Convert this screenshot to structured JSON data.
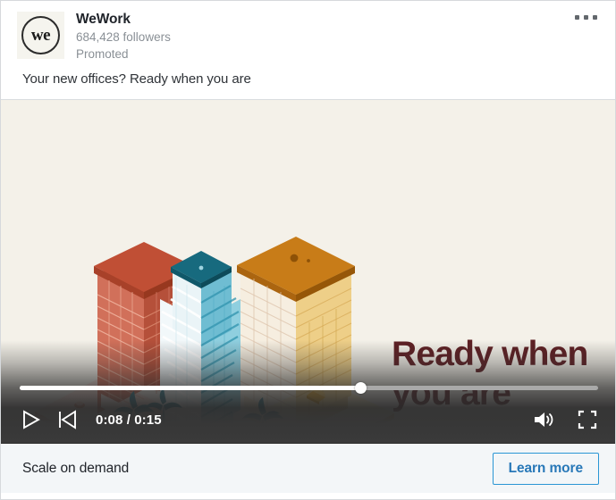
{
  "post": {
    "brand_name": "WeWork",
    "followers": "684,428 followers",
    "promoted_label": "Promoted",
    "avatar_text": "we",
    "commentary": "Your new offices? Ready when you are",
    "more_menu_label": "More options"
  },
  "video": {
    "headline": "Ready when\nyou are",
    "background_color": "#f4f1e9",
    "headline_color": "#5e1f23",
    "buildings": [
      {
        "name": "red-tower",
        "body_color": "#c4593f",
        "roof_color": "#bf4a33",
        "base_color": "#f6dad3"
      },
      {
        "name": "teal-twisting-tower",
        "body_color": "#4fb3cc",
        "roof_color": "#186a7c",
        "base_color": "#cfe4e6"
      },
      {
        "name": "yellow-tower",
        "body_color": "#f0d48a",
        "roof_color": "#c87a17",
        "base_color": "#f7e7bd"
      }
    ],
    "controls": {
      "play_label": "Play",
      "previous_label": "Previous",
      "time_current": "0:08",
      "time_separator": "/",
      "time_total": "0:15",
      "time_display": "0:08 / 0:15",
      "volume_label": "Volume",
      "fullscreen_label": "Fullscreen",
      "progress_percent": 59
    }
  },
  "cta": {
    "headline": "Scale on demand",
    "button_label": "Learn more",
    "button_color": "#2878b8",
    "button_border_color": "#2a96d4"
  }
}
